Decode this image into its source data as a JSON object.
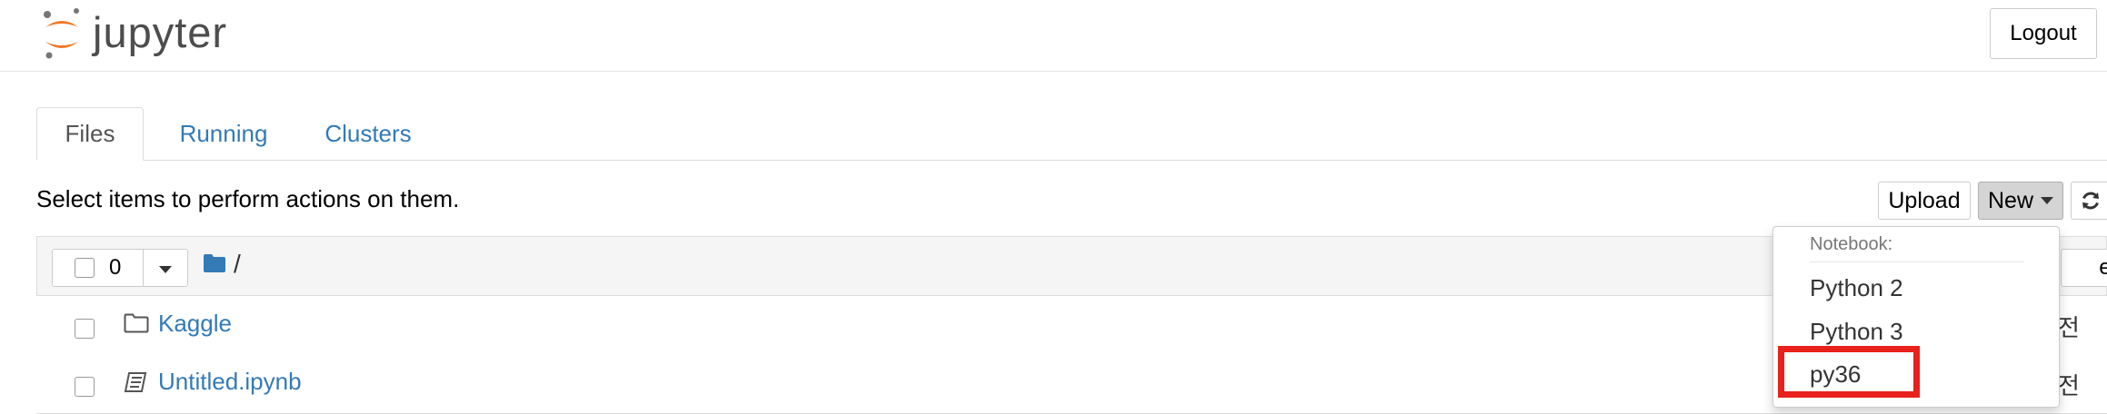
{
  "header": {
    "logo_text": "jupyter",
    "logout_label": "Logout"
  },
  "tabs": [
    {
      "label": "Files",
      "active": true
    },
    {
      "label": "Running",
      "active": false
    },
    {
      "label": "Clusters",
      "active": false
    }
  ],
  "toolbar": {
    "instructions": "Select items to perform actions on them.",
    "upload_label": "Upload",
    "new_label": "New",
    "refresh_icon": "refresh-icon"
  },
  "list_header": {
    "selected_count": "0",
    "breadcrumb_path": "/",
    "partial_button_label": "ed"
  },
  "files": [
    {
      "name": "Kaggle",
      "type": "folder",
      "modified": "전"
    },
    {
      "name": "Untitled.ipynb",
      "type": "notebook",
      "modified": "전"
    }
  ],
  "new_menu": {
    "section_header": "Notebook:",
    "items": [
      "Python 2",
      "Python 3",
      "py36"
    ],
    "highlighted_item": "py36"
  },
  "colors": {
    "link": "#337ab7",
    "highlight": "#e8211c",
    "logo_orange": "#f37726"
  }
}
